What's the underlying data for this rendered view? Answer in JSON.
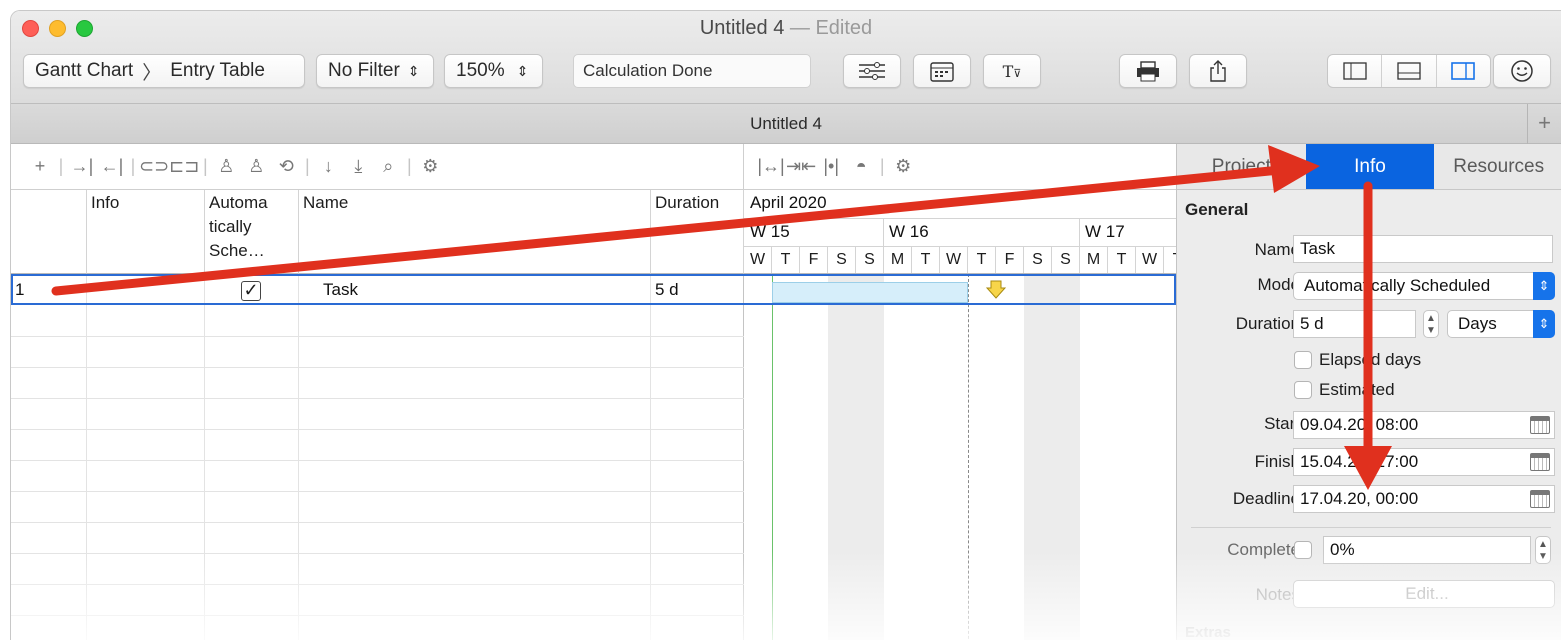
{
  "window": {
    "title": "Untitled 4",
    "edited": "— Edited"
  },
  "toolbar": {
    "view_mode": "Gantt Chart",
    "view_sep": "〉",
    "view_table": "Entry Table",
    "filter": "No Filter",
    "zoom": "150%",
    "status": "Calculation Done",
    "icons": [
      "sliders-icon",
      "calendar-icon",
      "text-style-icon",
      "print-icon",
      "share-icon",
      "sidebar-left-icon",
      "bottom-panel-icon",
      "sidebar-right-icon",
      "smiley-icon"
    ]
  },
  "tabbar": {
    "title": "Untitled 4",
    "plus": "+"
  },
  "table": {
    "headers": {
      "num": "",
      "info": "Info",
      "auto": "Automa\ntically\nSche…",
      "name": "Name",
      "duration": "Duration"
    },
    "rows": [
      {
        "num": "1",
        "info": "",
        "auto_checked": true,
        "checkmark": "✓",
        "name": "Task",
        "duration": "5 d"
      }
    ]
  },
  "gantt": {
    "month": "April 2020",
    "weeks": [
      "W 15",
      "W 16",
      "W 17"
    ],
    "days": [
      "W",
      "T",
      "F",
      "S",
      "S",
      "M",
      "T",
      "W",
      "T",
      "F",
      "S",
      "S",
      "M",
      "T",
      "W",
      "T"
    ]
  },
  "inspector": {
    "tabs": [
      "Project",
      "Info",
      "Resources"
    ],
    "active_tab": "Info",
    "section": "General",
    "name_label": "Name",
    "name_value": "Task",
    "mode_label": "Mode",
    "mode_value": "Automatically Scheduled",
    "duration_label": "Duration",
    "duration_value": "5 d",
    "duration_unit": "Days",
    "elapsed_label": "Elapsed days",
    "estimated_label": "Estimated",
    "start_label": "Start",
    "start_value": "09.04.20, 08:00",
    "finish_label": "Finish",
    "finish_value": "15.04.20, 17:00",
    "deadline_label": "Deadline",
    "deadline_value": "17.04.20, 00:00",
    "complete_label": "Complete",
    "complete_value": "0%",
    "notes_label": "Notes",
    "notes_button": "Edit...",
    "extras_label": "Extras"
  },
  "colors": {
    "accent": "#0a64e0",
    "selection": "#2a6bd4",
    "arrow": "#e0301e",
    "bar": "#d6eefa",
    "deadline": "#f7d54a"
  }
}
